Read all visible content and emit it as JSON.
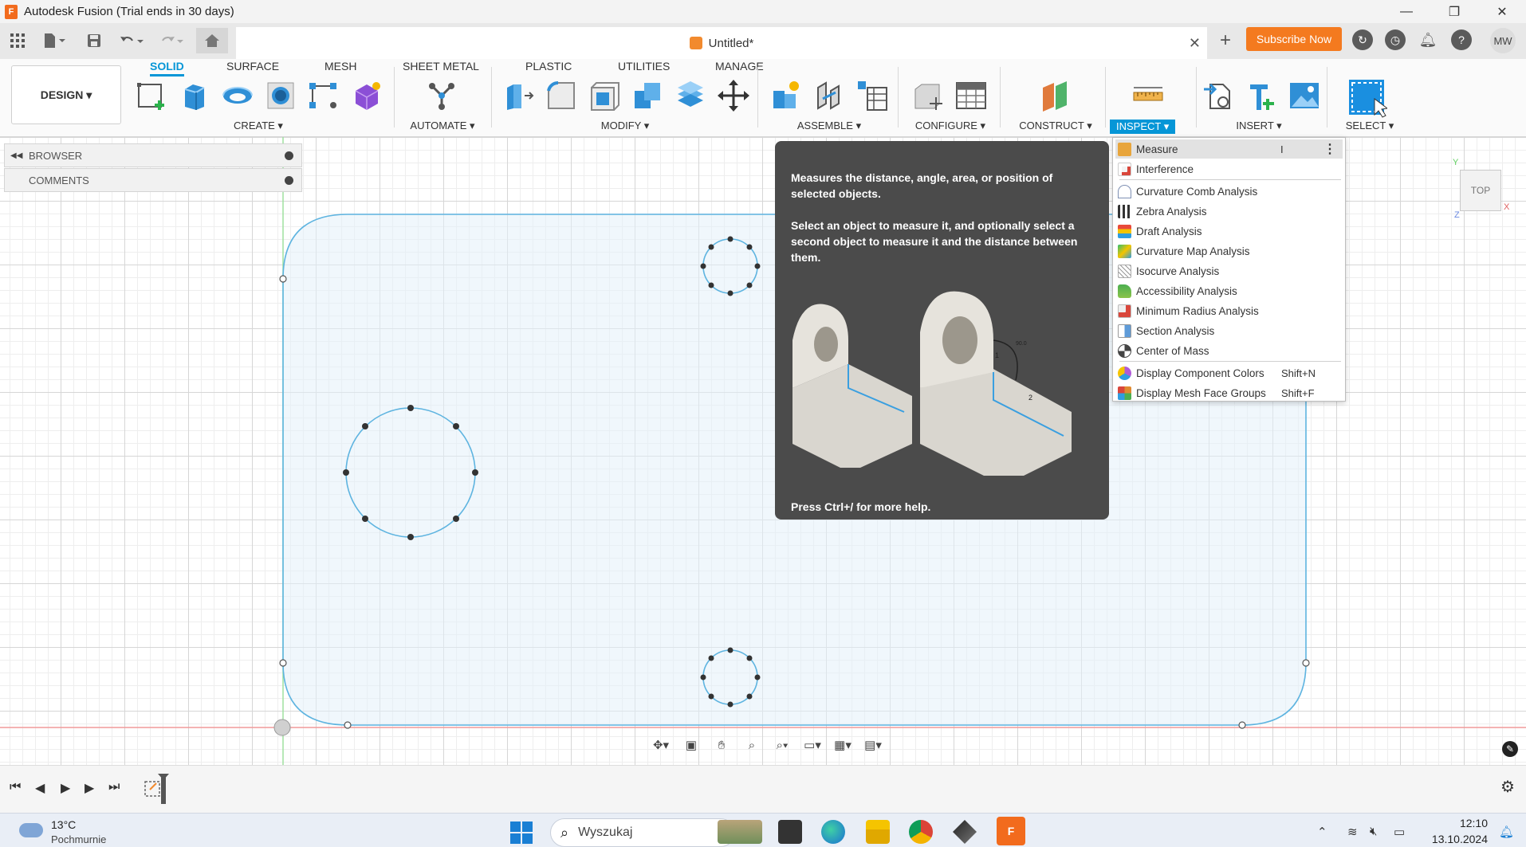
{
  "window": {
    "title": "Autodesk Fusion (Trial ends in 30 days)",
    "logo_letter": "F",
    "minimize": "—",
    "restore": "❐",
    "close": "✕"
  },
  "tabstrip": {
    "doc_title": "Untitled*",
    "close": "✕",
    "new_tab": "+",
    "subscribe": "Subscribe Now",
    "avatar": "MW"
  },
  "ribbon": {
    "workspace": "DESIGN ▾",
    "tabs": [
      "SOLID",
      "SURFACE",
      "MESH",
      "SHEET METAL",
      "PLASTIC",
      "UTILITIES",
      "MANAGE"
    ],
    "groups": [
      "CREATE ▾",
      "AUTOMATE ▾",
      "MODIFY ▾",
      "ASSEMBLE ▾",
      "CONFIGURE ▾",
      "CONSTRUCT ▾",
      "INSPECT ▾",
      "INSERT ▾",
      "SELECT ▾"
    ]
  },
  "browser": {
    "items": [
      "BROWSER",
      "COMMENTS"
    ]
  },
  "tooltip": {
    "line1": "Measures the distance, angle, area, or position of selected objects.",
    "line2": "Select an object to measure it, and optionally select a second object to measure it and the distance between them.",
    "footer": "Press Ctrl+/ for more help.",
    "figure_labels": [
      "1",
      "2",
      "90.0"
    ]
  },
  "inspect_menu": {
    "items": [
      {
        "label": "Measure",
        "shortcut": "I",
        "color": "#e8a53c"
      },
      {
        "label": "Interference",
        "shortcut": "",
        "color": "#d9463b"
      },
      {
        "label": "Curvature Comb Analysis",
        "shortcut": "",
        "color": "#7e8fb3"
      },
      {
        "label": "Zebra Analysis",
        "shortcut": "",
        "color": "#333333"
      },
      {
        "label": "Draft Analysis",
        "shortcut": "",
        "color": "#2f9de0"
      },
      {
        "label": "Curvature Map Analysis",
        "shortcut": "",
        "color": "#2fbf71"
      },
      {
        "label": "Isocurve Analysis",
        "shortcut": "",
        "color": "#8a8a8a"
      },
      {
        "label": "Accessibility Analysis",
        "shortcut": "",
        "color": "#4caf50"
      },
      {
        "label": "Minimum Radius Analysis",
        "shortcut": "",
        "color": "#d9463b"
      },
      {
        "label": "Section Analysis",
        "shortcut": "",
        "color": "#5f9bd8"
      },
      {
        "label": "Center of Mass",
        "shortcut": "",
        "color": "#444444"
      },
      {
        "label": "Display Component Colors",
        "shortcut": "Shift+N",
        "color": "#b05bd6"
      },
      {
        "label": "Display Mesh Face Groups",
        "shortcut": "Shift+F",
        "color": "#e08a2f"
      }
    ],
    "more": "⋮"
  },
  "viewcube": {
    "face": "TOP",
    "axis_x": "X",
    "axis_y": "Y",
    "axis_z": "Z"
  },
  "navbar": {
    "icons": [
      "orbit-icon",
      "look-at-icon",
      "pan-icon",
      "zoom-icon",
      "zoom-window-icon",
      "display-settings-icon",
      "grid-icon",
      "viewports-icon"
    ]
  },
  "timeline": {
    "controls": [
      "⏮",
      "◀",
      "▶",
      "▶",
      "⏭"
    ],
    "settings": "⚙"
  },
  "taskbar": {
    "weather_temp": "13°C",
    "weather_desc": "Pochmurnie",
    "search_placeholder": "Wyszukaj",
    "time": "12:10",
    "date": "13.10.2024"
  }
}
